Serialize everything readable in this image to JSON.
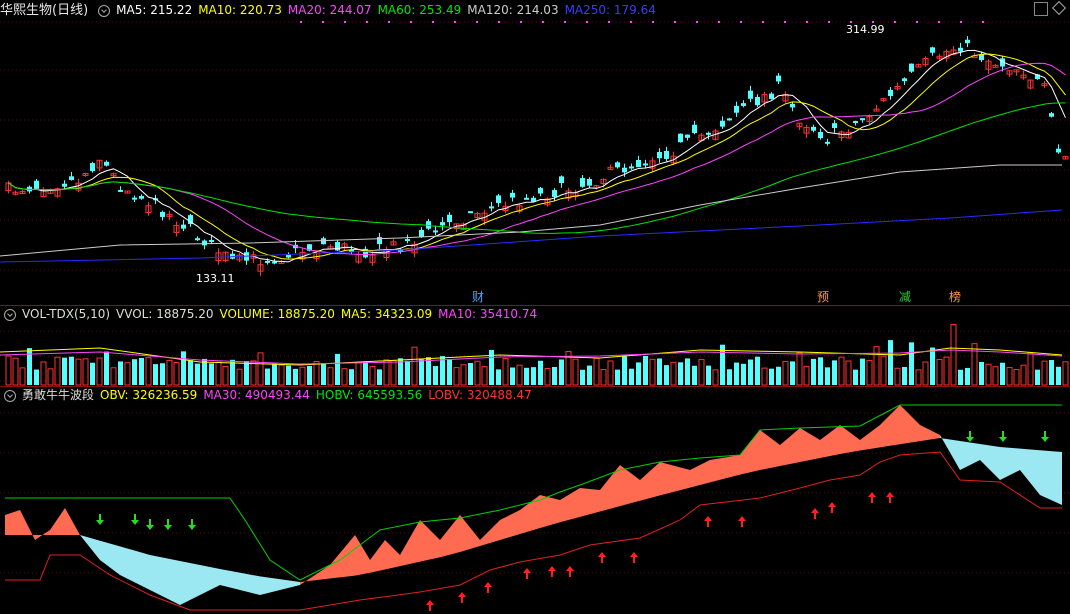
{
  "main": {
    "stock_name": "华熙生物(日线)",
    "ma5": "MA5: 215.22",
    "ma10": "MA10: 220.73",
    "ma20": "MA20: 244.07",
    "ma60": "MA60: 253.49",
    "ma120": "MA120: 214.03",
    "ma250": "MA250: 179.64",
    "high_label": "314.99",
    "low_label": "133.11",
    "events": [
      "财",
      "预",
      "减",
      "榜"
    ]
  },
  "volume": {
    "name": "VOL-TDX(5,10)",
    "vvol": "VVOL: 18875.20",
    "volume": "VOLUME: 18875.20",
    "ma5": "MA5: 34323.09",
    "ma10": "MA10: 35410.74"
  },
  "indicator": {
    "name": "勇敢牛牛波段",
    "obv": "OBV: 326236.59",
    "ma30": "MA30: 490493.44",
    "hobv": "HOBV: 645593.56",
    "lobv": "LOBV: 320488.47"
  },
  "colors": {
    "up": "#ff3232",
    "down": "#54ffff",
    "ma5": "#ffffff",
    "ma10": "#ffff00",
    "ma20": "#ff44ff",
    "ma60": "#00e600",
    "ma120": "#cccccc",
    "ma250": "#2a2aff",
    "obv_up_fill": "#ff6b50",
    "obv_down_fill": "#9be8f2"
  }
}
